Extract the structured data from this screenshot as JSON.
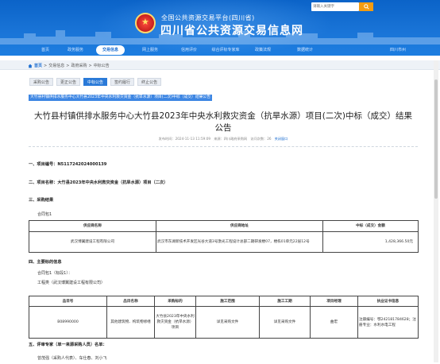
{
  "header": {
    "subtitle": "全国公共资源交易平台(四川省)",
    "title": "四川省公共资源交易信息网",
    "search_placeholder": "请输入关键字",
    "brand_color": "#1a75d8"
  },
  "nav": {
    "items": [
      {
        "label": "首页",
        "active": false
      },
      {
        "label": "政务服务",
        "active": false
      },
      {
        "label": "交易信息",
        "active": true
      },
      {
        "label": "网上服务",
        "active": false
      },
      {
        "label": "信用评价",
        "active": false
      },
      {
        "label": "综合评标专家库",
        "active": false
      },
      {
        "label": "政策法规",
        "active": false
      },
      {
        "label": "数据统计",
        "active": false
      },
      {
        "label": "四川市州",
        "active": false
      }
    ]
  },
  "breadcrumb": {
    "home": "首页",
    "sep": ">",
    "items": [
      "交易信息",
      "政府采购",
      "中标公告"
    ]
  },
  "tabs": [
    {
      "label": "采购公告",
      "active": false
    },
    {
      "label": "更正公告",
      "active": false
    },
    {
      "label": "中标公告",
      "active": true
    },
    {
      "label": "签约履行",
      "active": false
    },
    {
      "label": "终止公告",
      "active": false
    }
  ],
  "selected_banner": "大竹县村镇供排水服务中心大竹县2023年中央水利救灾资金（抗旱水源）项目(二次)中标（成交）结果公告",
  "article": {
    "title_line1": "大竹县村镇供排水服务中心大竹县2023年中央水利救灾资金（抗旱水源）项目(二次)中标（成交）结果",
    "title_line2": "公告",
    "meta": "发布时间：2024-11-13 11:59:09　来源：四川政府采购网　访问次数：26",
    "print_label": "关闭窗口"
  },
  "sections": {
    "s1": "一、项目编号：N5117242024000139",
    "s2": "二、项目名称：大竹县2023年中央水利救灾资金（抗旱水源）项目（二次）",
    "s3": "三、采购结果",
    "s3_pkg": "合同包1",
    "s4": "四、主要标的信息",
    "s4_pkg": "合同包1（标段1）：",
    "s4_type": "工程类（武汉博翼建设工程有限公司）",
    "s5": "五、评审专家（单一来源采购人员）名单：",
    "s5_names": "曾茂强（采购人代表）、车仕春、刘小飞"
  },
  "result_table": {
    "headers": [
      "供应商名称",
      "供应商地址",
      "中标（成交）金额"
    ],
    "row": {
      "name": "武汉博翼建设工程有限公司",
      "address": "武汉市东湖新技术开发区光谷大道3号激光工程设计总部二期研发楼07，楼栋01单元22层12号",
      "amount": "1,428,366.50元"
    }
  },
  "detail_table": {
    "headers": [
      "品目号",
      "品目名称",
      "采购标的",
      "施工范围",
      "施工工期",
      "项目经理",
      "执业证书信息"
    ],
    "row": {
      "code": "B08990000",
      "category": "其他建筑物、构筑物修缮",
      "target": "大竹县2023年中央水利救灾资金（抗旱水源）项目",
      "scope": "详见采购文件",
      "period": "详见采购文件",
      "manager": "曲宏",
      "cert": "注册编号：鄂242181784628；注册专业：水利水电工程"
    }
  }
}
